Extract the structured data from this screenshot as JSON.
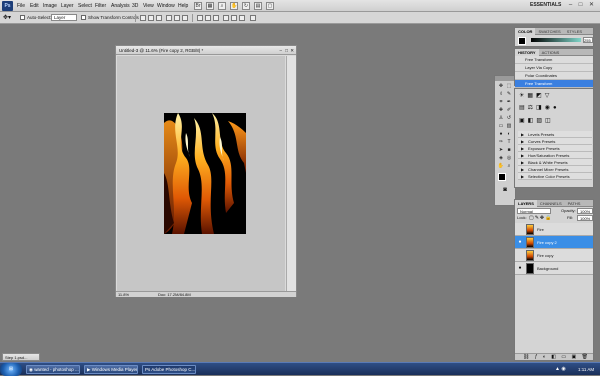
{
  "app": {
    "logo_text": "Ps",
    "menus": [
      "File",
      "Edit",
      "Image",
      "Layer",
      "Select",
      "Filter",
      "Analysis",
      "3D",
      "View",
      "Window",
      "Help"
    ],
    "workspace": "ESSENTIALS",
    "win_buttons": [
      "–",
      "□",
      "✕"
    ]
  },
  "options_bar": {
    "auto_select_label": "Auto-Select:",
    "auto_select_value": "Layer",
    "show_transform_label": "Show Transform Controls"
  },
  "document": {
    "title": "Untitled-3 @ 11.6% (Fire copy 2, RGB/8) *",
    "zoom": "11.8%",
    "doc_info": "Doc: 17.2M/84.8M"
  },
  "color_panel": {
    "tabs": [
      "COLOR",
      "SWATCHES",
      "STYLES"
    ],
    "value": "255"
  },
  "history_panel": {
    "tabs": [
      "HISTORY",
      "ACTIONS"
    ],
    "items": [
      "Free Transform",
      "Layer Via Copy",
      "Polar Coordinates",
      "Free Transform"
    ],
    "active_index": 3
  },
  "adjustments_panel": {
    "presets": [
      "Levels Presets",
      "Curves Presets",
      "Exposure Presets",
      "Hue/Saturation Presets",
      "Black & White Presets",
      "Channel Mixer Presets",
      "Selective Color Presets"
    ]
  },
  "layers_panel": {
    "tabs": [
      "LAYERS",
      "CHANNELS",
      "PATHS"
    ],
    "blend_mode": "Normal",
    "opacity_label": "Opacity:",
    "opacity_value": "100%",
    "lock_label": "Lock:",
    "fill_label": "Fill:",
    "fill_value": "100%",
    "layers": [
      {
        "name": "Fire",
        "visible": false,
        "type": "fire"
      },
      {
        "name": "Fire copy 2",
        "visible": true,
        "type": "fire",
        "active": true
      },
      {
        "name": "Fire copy",
        "visible": false,
        "type": "fire"
      },
      {
        "name": "Background",
        "visible": true,
        "type": "black"
      }
    ]
  },
  "minimized_doc": "Step 1.psd...",
  "taskbar": {
    "start_label": "",
    "tasks": [
      "wanted - photoshop ...",
      "Windows Media Player",
      "Adobe Photoshop C..."
    ],
    "clock": "1:11 AM"
  },
  "colors": {
    "accent": "#3a8ee6",
    "history_active": "#3a7fe0",
    "workspace_bg": "#7a7a7a"
  }
}
